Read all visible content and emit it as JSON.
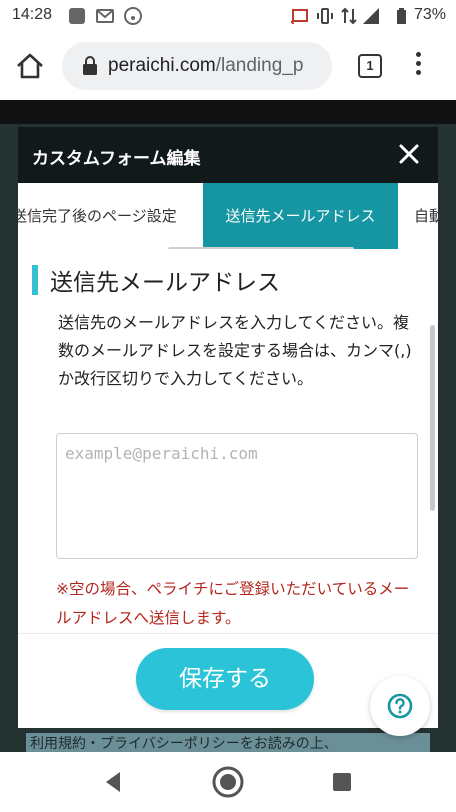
{
  "status_bar": {
    "time": "14:28",
    "battery": "73%",
    "icons": [
      "photo-icon",
      "gmail-icon",
      "wifi-icon",
      "cast-icon",
      "vibrate-icon",
      "data-icon",
      "signal-icon",
      "battery-icon"
    ]
  },
  "browser": {
    "url_domain": "peraichi.com",
    "url_path": "/landing_p",
    "tab_count": "1"
  },
  "modal": {
    "title": "カスタムフォーム編集",
    "tabs": [
      {
        "label": "送信完了後のページ設定"
      },
      {
        "label": "送信先メールアドレス"
      },
      {
        "label": "自動"
      }
    ],
    "section_title": "送信先メールアドレス",
    "description": "送信先のメールアドレスを入力してください。複数のメールアドレスを設定する場合は、カンマ(,)か改行区切りで入力してください。",
    "email_placeholder": "example@peraichi.com",
    "email_value": "",
    "note": "※空の場合、ペライチにご登録いただいているメールアドレスへ送信します。",
    "save_label": "保存する"
  },
  "background": {
    "terms_text": "利用規約・プライバシーポリシーをお読みの上、"
  },
  "colors": {
    "accent_teal": "#1596a2",
    "button_cyan": "#2ac3d7",
    "note_red": "#b3261e",
    "header_dark": "#11191b"
  }
}
